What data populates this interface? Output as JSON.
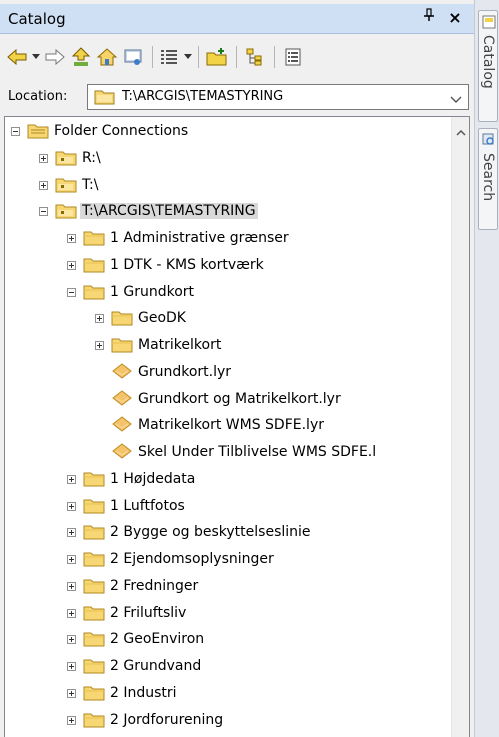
{
  "window": {
    "title": "Catalog",
    "pin_icon": "pin-icon",
    "close_glyph": "×"
  },
  "location": {
    "label": "Location:",
    "value": "T:\\ARCGIS\\TEMASTYRING"
  },
  "side_tabs": [
    {
      "label": "Catalog"
    },
    {
      "label": "Search"
    }
  ],
  "tree": {
    "nodes": [
      {
        "label": "Folder Connections",
        "icon": "folder-connections-icon",
        "expander": "minus",
        "level": 0
      },
      {
        "label": "R:\\",
        "icon": "folder-connection-icon",
        "expander": "plus",
        "level": 1
      },
      {
        "label": "T:\\",
        "icon": "folder-connection-icon",
        "expander": "plus",
        "level": 1
      },
      {
        "label": "T:\\ARCGIS\\TEMASTYRING",
        "icon": "folder-connection-icon",
        "expander": "minus",
        "level": 1,
        "selected": true
      },
      {
        "label": "1 Administrative grænser",
        "icon": "folder-icon",
        "expander": "plus",
        "level": 2
      },
      {
        "label": "1 DTK - KMS kortværk",
        "icon": "folder-icon",
        "expander": "plus",
        "level": 2
      },
      {
        "label": "1 Grundkort",
        "icon": "folder-icon",
        "expander": "minus",
        "level": 2
      },
      {
        "label": "GeoDK",
        "icon": "folder-icon",
        "expander": "plus",
        "level": 3
      },
      {
        "label": "Matrikelkort",
        "icon": "folder-icon",
        "expander": "plus",
        "level": 3
      },
      {
        "label": "Grundkort.lyr",
        "icon": "layer-file-icon",
        "expander": "none",
        "level": 3
      },
      {
        "label": "Grundkort og Matrikelkort.lyr",
        "icon": "layer-file-icon",
        "expander": "none",
        "level": 3
      },
      {
        "label": "Matrikelkort WMS SDFE.lyr",
        "icon": "layer-file-icon",
        "expander": "none",
        "level": 3
      },
      {
        "label": "Skel Under Tilblivelse WMS SDFE.l",
        "icon": "layer-file-icon",
        "expander": "none",
        "level": 3
      },
      {
        "label": "1 Højdedata",
        "icon": "folder-icon",
        "expander": "plus",
        "level": 2
      },
      {
        "label": "1 Luftfotos",
        "icon": "folder-icon",
        "expander": "plus",
        "level": 2
      },
      {
        "label": "2 Bygge og beskyttelseslinie",
        "icon": "folder-icon",
        "expander": "plus",
        "level": 2
      },
      {
        "label": "2 Ejendomsoplysninger",
        "icon": "folder-icon",
        "expander": "plus",
        "level": 2
      },
      {
        "label": "2 Fredninger",
        "icon": "folder-icon",
        "expander": "plus",
        "level": 2
      },
      {
        "label": "2 Friluftsliv",
        "icon": "folder-icon",
        "expander": "plus",
        "level": 2
      },
      {
        "label": "2 GeoEnviron",
        "icon": "folder-icon",
        "expander": "plus",
        "level": 2
      },
      {
        "label": "2 Grundvand",
        "icon": "folder-icon",
        "expander": "plus",
        "level": 2
      },
      {
        "label": "2 Industri",
        "icon": "folder-icon",
        "expander": "plus",
        "level": 2
      },
      {
        "label": "2 Jordforurening",
        "icon": "folder-icon",
        "expander": "plus",
        "level": 2
      }
    ]
  },
  "colors": {
    "titlebar": "#cfe0f4",
    "folder": "#f7d774",
    "layer_file": "#f4c46a",
    "selection": "#d9d9d9"
  }
}
